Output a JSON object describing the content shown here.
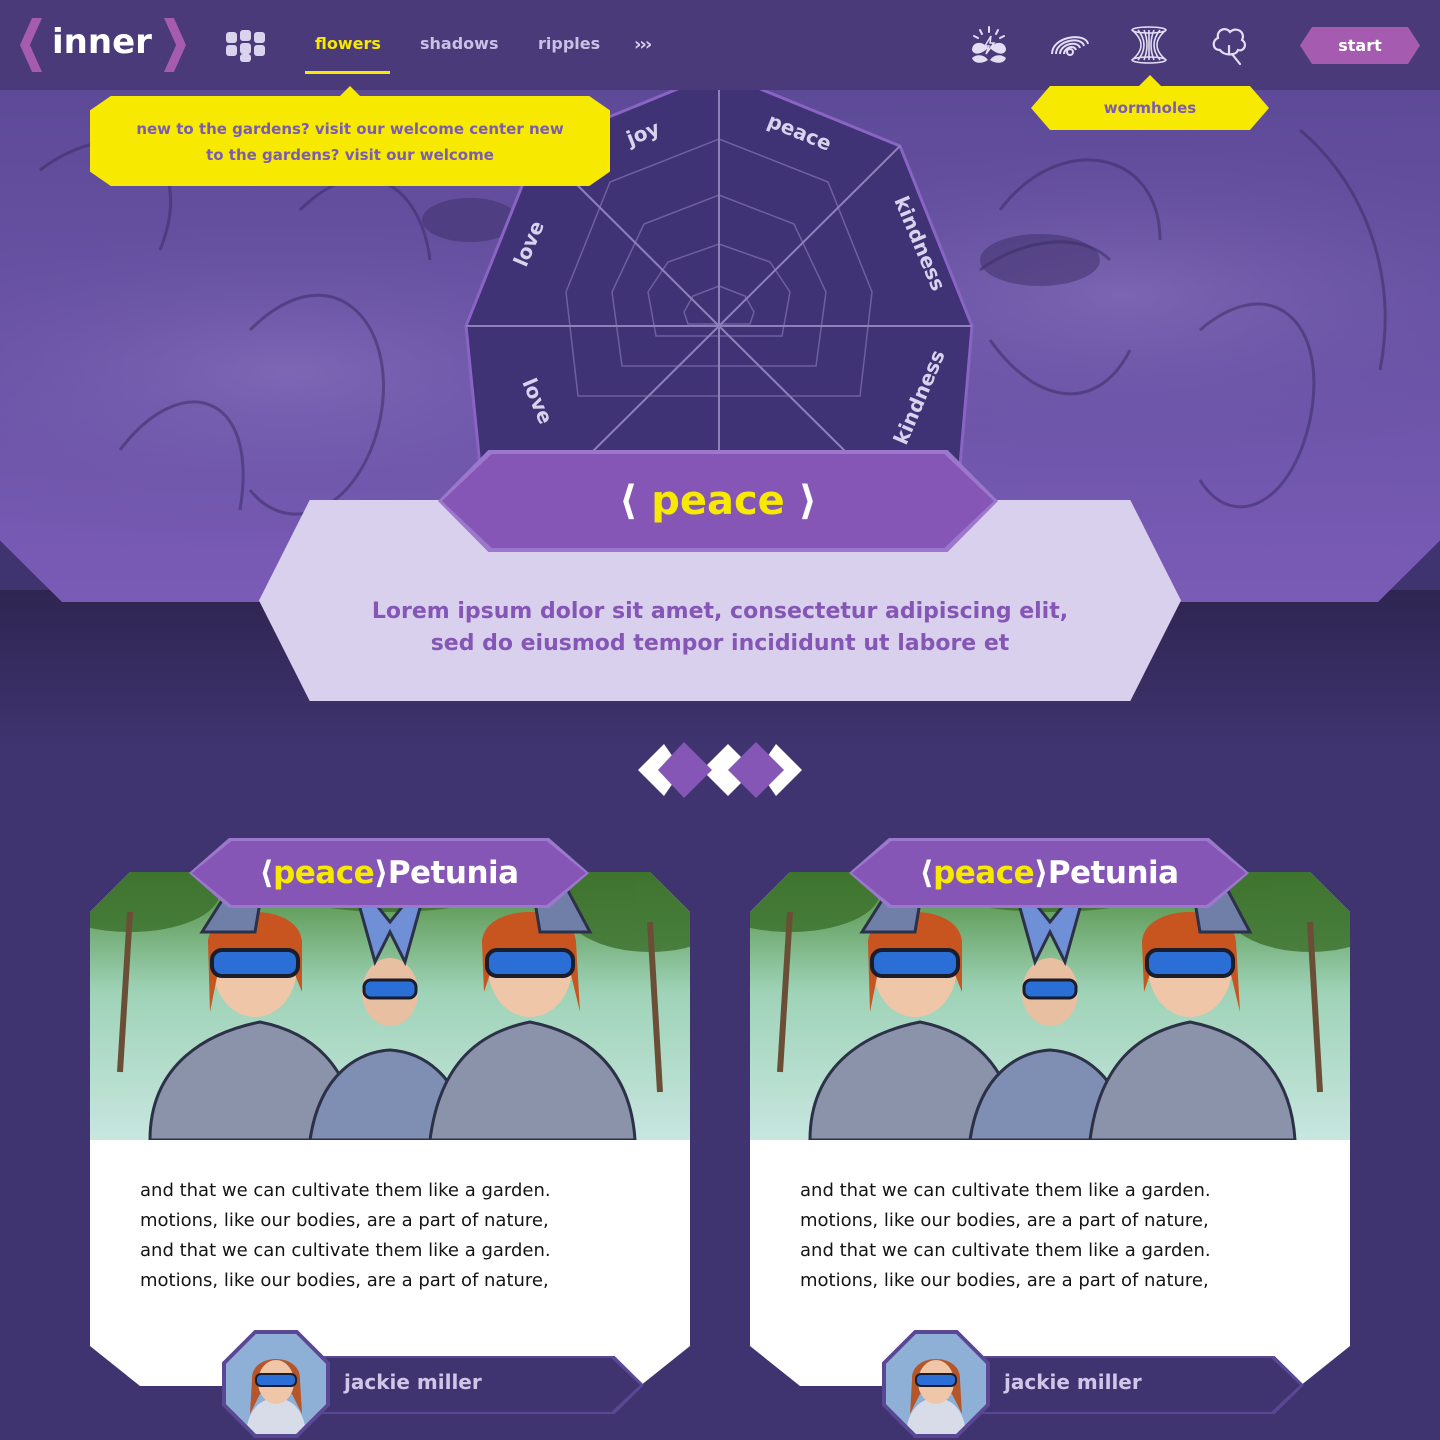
{
  "header": {
    "logo_text": "inner",
    "tabs": [
      {
        "label": "flowers",
        "active": true
      },
      {
        "label": "shadows",
        "active": false
      },
      {
        "label": "ripples",
        "active": false
      }
    ],
    "more_label": "›››",
    "icons": [
      "lightning-leaf-icon",
      "swirl-rainbow-icon",
      "wormhole-icon",
      "tree-search-icon"
    ],
    "start_label": "start"
  },
  "tooltips": {
    "welcome": "new to the gardens? visit our welcome center new to the gardens? visit our welcome",
    "wormholes": "wormholes"
  },
  "radar": {
    "segments": [
      "joy",
      "peace",
      "kindness",
      "kindness",
      "love",
      "love"
    ]
  },
  "feature": {
    "title_open": "⟨",
    "title": "peace",
    "title_close": "⟩",
    "description": "Lorem ipsum dolor sit amet, consectetur adipiscing elit, sed do eiusmod tempor incididunt ut labore et"
  },
  "cards": [
    {
      "title_open": "⟨",
      "title_tag": "peace",
      "title_close": "⟩",
      "title_name": "Petunia",
      "lines": [
        "and that we can cultivate them like a garden.",
        "motions, like our bodies, are a part of nature,",
        "and that we can cultivate them like a garden.",
        "motions, like our bodies, are a part of nature,"
      ],
      "author": "jackie miller"
    },
    {
      "title_open": "⟨",
      "title_tag": "peace",
      "title_close": "⟩",
      "title_name": "Petunia",
      "lines": [
        "and that we can cultivate them like a garden.",
        "motions, like our bodies, are a part of nature,",
        "and that we can cultivate them like a garden.",
        "motions, like our bodies, are a part of nature,"
      ],
      "author": "jackie miller"
    }
  ],
  "colors": {
    "accent_yellow": "#f7ea00",
    "purple": "#8656b6",
    "background": "#3f3470"
  }
}
